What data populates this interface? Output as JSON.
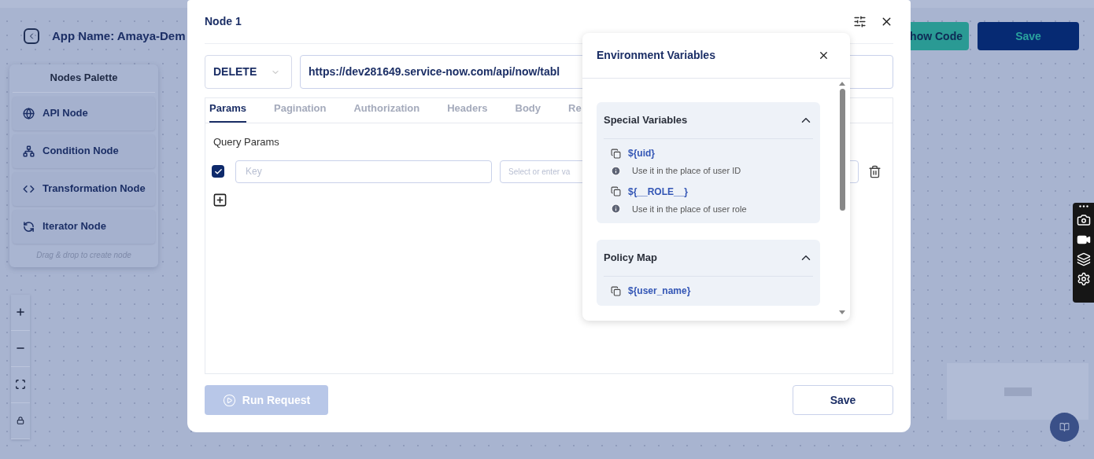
{
  "app_header": {
    "app_name": "App Name: Amaya-Dem",
    "buttons": [
      {
        "label": "how Code",
        "kind": "secondary"
      },
      {
        "label": "Save",
        "kind": "primary"
      }
    ]
  },
  "nodes_palette": {
    "title": "Nodes Palette",
    "items": [
      {
        "label": "API Node",
        "kind": "api"
      },
      {
        "label": "Condition Node",
        "kind": "condition"
      },
      {
        "label": "Transformation Node",
        "kind": "transformation"
      },
      {
        "label": "Iterator Node",
        "kind": "iterator"
      }
    ],
    "hint": "Drag & drop to create node"
  },
  "modal": {
    "title": "Node 1",
    "method": "DELETE",
    "url": "https://dev281649.service-now.com/api/now/tabl",
    "tabs": [
      {
        "label": "Params",
        "selected": true
      },
      {
        "label": "Pagination",
        "selected": false
      },
      {
        "label": "Authorization",
        "selected": false
      },
      {
        "label": "Headers",
        "selected": false
      },
      {
        "label": "Body",
        "selected": false
      },
      {
        "label": "Re",
        "selected": false
      }
    ],
    "section_title": "Query Params",
    "params": [
      {
        "checked": true,
        "key_placeholder": "Key",
        "value_placeholder": "Select or enter va"
      }
    ],
    "run_button": {
      "label": "Run Request",
      "disabled": true
    },
    "save_button": "Save"
  },
  "env_popover": {
    "title": "Environment Variables",
    "sections": [
      {
        "title": "Special Variables",
        "expanded": true,
        "variables": [
          {
            "name": "${uid}",
            "description": "Use it in the place of user ID"
          },
          {
            "name": "${__ROLE__}",
            "description": "Use it in the place of user role"
          }
        ]
      },
      {
        "title": "Policy Map",
        "expanded": true,
        "variables": [
          {
            "name": "${user_name}"
          }
        ]
      }
    ]
  }
}
